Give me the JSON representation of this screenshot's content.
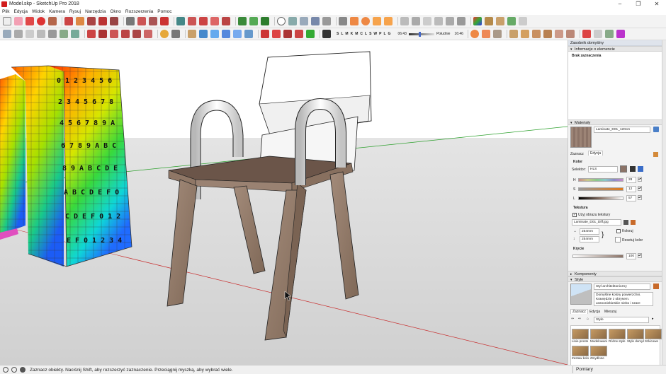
{
  "window": {
    "title": "Model.skp - SketchUp Pro 2018",
    "controls": [
      "–",
      "❐",
      "✕"
    ]
  },
  "menu": [
    "Plik",
    "Edycja",
    "Widok",
    "Kamera",
    "Rysuj",
    "Narzędzia",
    "Okno",
    "Rozszerzenia",
    "Pomoc"
  ],
  "shadow_bar": {
    "months": [
      "S",
      "L",
      "M",
      "K",
      "M",
      "C",
      "L",
      "S",
      "W",
      "P",
      "L",
      "G"
    ],
    "time_start": "06:43",
    "time_mid": "Południe",
    "time_end": "16:46"
  },
  "tray": {
    "title": "Zasobnik domyślny",
    "entity_info": {
      "header": "Informacje o elemencie",
      "status": "Brak zaznaczenia"
    },
    "materials": {
      "header": "Materiały",
      "material_name": "Laminate_D01_120cm",
      "tabs": [
        "Zaznacz",
        "Edycja"
      ],
      "color_label": "Kolor",
      "picker_label": "Selektor:",
      "picker_value": "HLS",
      "h_label": "H",
      "h_value": "28",
      "s_label": "S",
      "s_value": "12",
      "l_label": "L",
      "l_value": "57",
      "texture_label": "Tekstura",
      "use_texture_label": "Użyj obrazu tekstury",
      "texture_file": "Laminate_D01_Diff.jpg",
      "width_value": "254mm",
      "height_value": "254mm",
      "colorize_label": "Koloruj",
      "reset_color_label": "Resetuj kolor",
      "opacity_label": "Krycie",
      "opacity_value": "100"
    },
    "components": {
      "header": "Komponenty"
    },
    "styles": {
      "header": "Style",
      "style_name": "Styl architektoniczny",
      "style_desc": "Domyślne kolory powierzchni. Krawędzie z obrysem. Jasnoniebieskie niebo i szare",
      "tabs": [
        "Zaznacz",
        "Edycja",
        "Mieszaj"
      ],
      "collection": "Style",
      "tiles": [
        "Linie proste",
        "Modelowanie",
        "Różne style",
        "Style domyślne",
        "Szkicowe",
        "Zestaw kolorów",
        "Zmydlone"
      ]
    }
  },
  "status": {
    "message": "Zaznacz obiekty. Naciśnij Shift, aby rozszerzyć zaznaczenie. Przeciągnij myszką, aby wybrać wiele.",
    "measurements_label": "Pomiary"
  },
  "colors": {
    "axis_red": "#c83232",
    "axis_green": "#2ca02c",
    "chair_wood": "#8f7766",
    "seat_top": "#6b5549",
    "sky": "#ffffff",
    "ground": "#d6d6d6"
  }
}
